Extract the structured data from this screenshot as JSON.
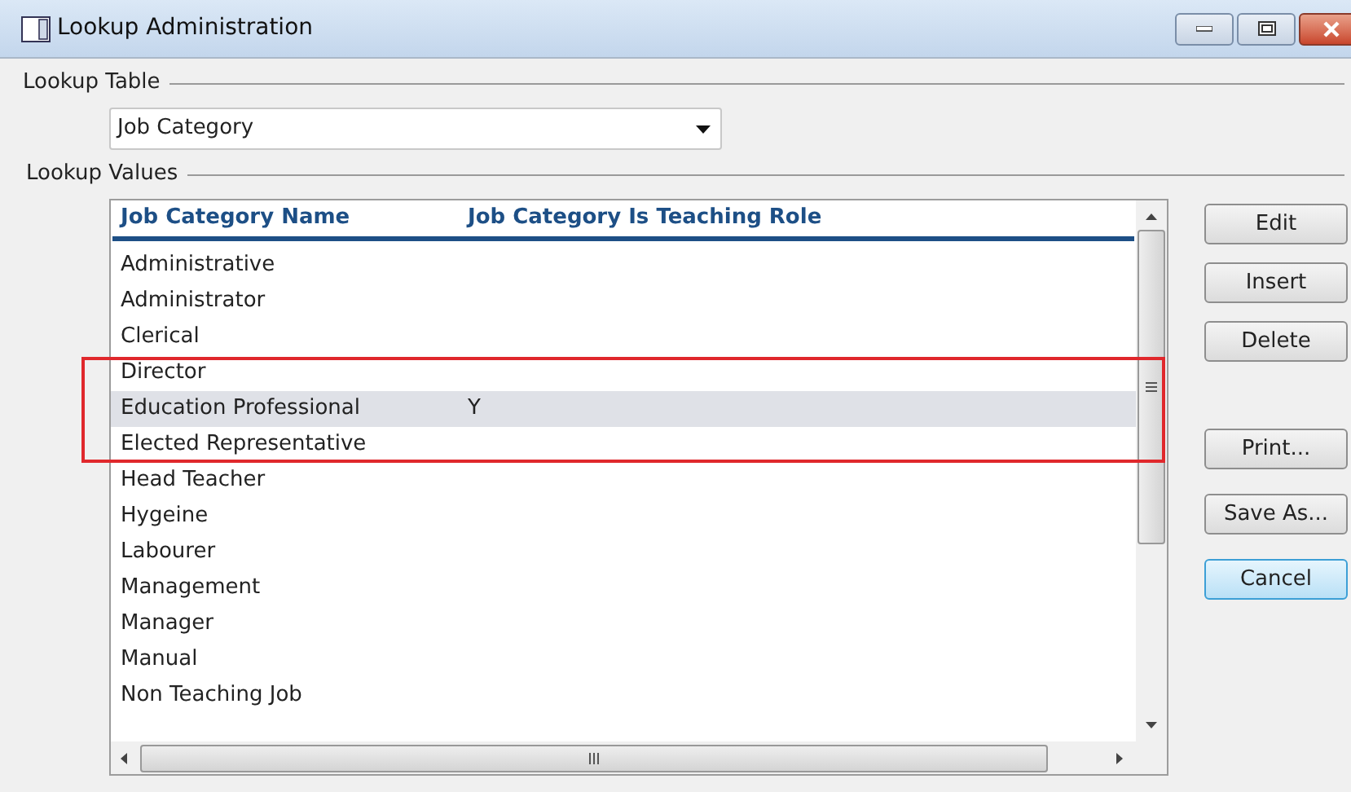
{
  "window": {
    "title": "Lookup Administration"
  },
  "lookup_table": {
    "label": "Lookup Table",
    "value": "Job Category"
  },
  "lookup_values": {
    "label": "Lookup Values"
  },
  "table": {
    "columns": [
      "Job Category Name",
      "Job Category Is Teaching Role"
    ],
    "rows": [
      {
        "cells": [
          "Administrative",
          ""
        ],
        "selected": false
      },
      {
        "cells": [
          "Administrator",
          ""
        ],
        "selected": false
      },
      {
        "cells": [
          "Clerical",
          ""
        ],
        "selected": false
      },
      {
        "cells": [
          "Director",
          ""
        ],
        "selected": false
      },
      {
        "cells": [
          "Education Professional",
          "Y"
        ],
        "selected": true
      },
      {
        "cells": [
          "Elected Representative",
          ""
        ],
        "selected": false
      },
      {
        "cells": [
          "Head Teacher",
          ""
        ],
        "selected": false
      },
      {
        "cells": [
          "Hygeine",
          ""
        ],
        "selected": false
      },
      {
        "cells": [
          "Labourer",
          ""
        ],
        "selected": false
      },
      {
        "cells": [
          "Management",
          ""
        ],
        "selected": false
      },
      {
        "cells": [
          "Manager",
          ""
        ],
        "selected": false
      },
      {
        "cells": [
          "Manual",
          ""
        ],
        "selected": false
      },
      {
        "cells": [
          "Non Teaching Job",
          ""
        ],
        "selected": false
      }
    ]
  },
  "buttons": [
    {
      "label": "Edit",
      "focused": false
    },
    {
      "label": "Insert",
      "focused": false
    },
    {
      "label": "Delete",
      "focused": false
    },
    {
      "label": "Print...",
      "focused": false
    },
    {
      "label": "Save As...",
      "focused": false
    },
    {
      "label": "Cancel",
      "focused": true
    }
  ]
}
